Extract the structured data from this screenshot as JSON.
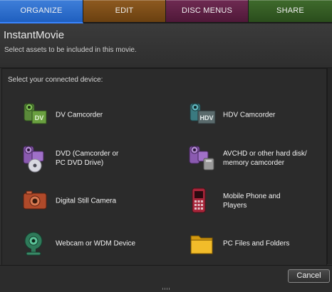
{
  "tabs": [
    {
      "label": "ORGANIZE",
      "active": true
    },
    {
      "label": "EDIT"
    },
    {
      "label": "DISC MENUS"
    },
    {
      "label": "SHARE"
    }
  ],
  "header": {
    "title": "InstantMovie",
    "subtitle": "Select assets to be included in this movie."
  },
  "panel": {
    "prompt": "Select your connected device:",
    "devices": [
      {
        "label": "DV Camcorder",
        "icon": "dv-camcorder-icon"
      },
      {
        "label": "HDV Camcorder",
        "icon": "hdv-camcorder-icon"
      },
      {
        "label": "DVD (Camcorder or\nPC DVD Drive)",
        "icon": "dvd-camcorder-icon"
      },
      {
        "label": "AVCHD or other hard disk/\nmemory camcorder",
        "icon": "avchd-camcorder-icon"
      },
      {
        "label": "Digital Still Camera",
        "icon": "digital-still-camera-icon"
      },
      {
        "label": "Mobile Phone and\nPlayers",
        "icon": "mobile-phone-icon"
      },
      {
        "label": "Webcam or WDM Device",
        "icon": "webcam-icon"
      },
      {
        "label": "PC Files and Folders",
        "icon": "folder-icon"
      }
    ]
  },
  "footer": {
    "cancel_label": "Cancel"
  },
  "colors": {
    "organize": "#2f6fcf",
    "edit": "#7a4c18",
    "disc_menus": "#5e2046",
    "share": "#34592a",
    "background": "#2f2f2f"
  }
}
